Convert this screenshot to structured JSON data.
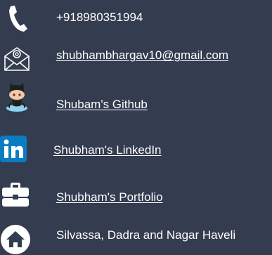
{
  "contact": {
    "phone": {
      "icon": "phone-icon",
      "text": "+918980351994"
    },
    "email": {
      "icon": "mail-icon",
      "text": "shubhambhargav10@gmail.com"
    },
    "github": {
      "icon": "github-octocat-icon",
      "text": "Shubam's Github"
    },
    "linkedin": {
      "icon": "linkedin-icon",
      "text": "Shubham's LinkedIn"
    },
    "portfolio": {
      "icon": "briefcase-icon",
      "text": "Shubham's  Portfolio"
    },
    "location": {
      "icon": "home-icon",
      "text": "Silvassa, Dadra and Nagar Haveli"
    }
  },
  "colors": {
    "background": "#343c4f",
    "text": "#ffffff",
    "linkedin_blue": "#0a7cc1",
    "github_skin": "#f2c9a7",
    "github_water": "#8fd3ec"
  }
}
